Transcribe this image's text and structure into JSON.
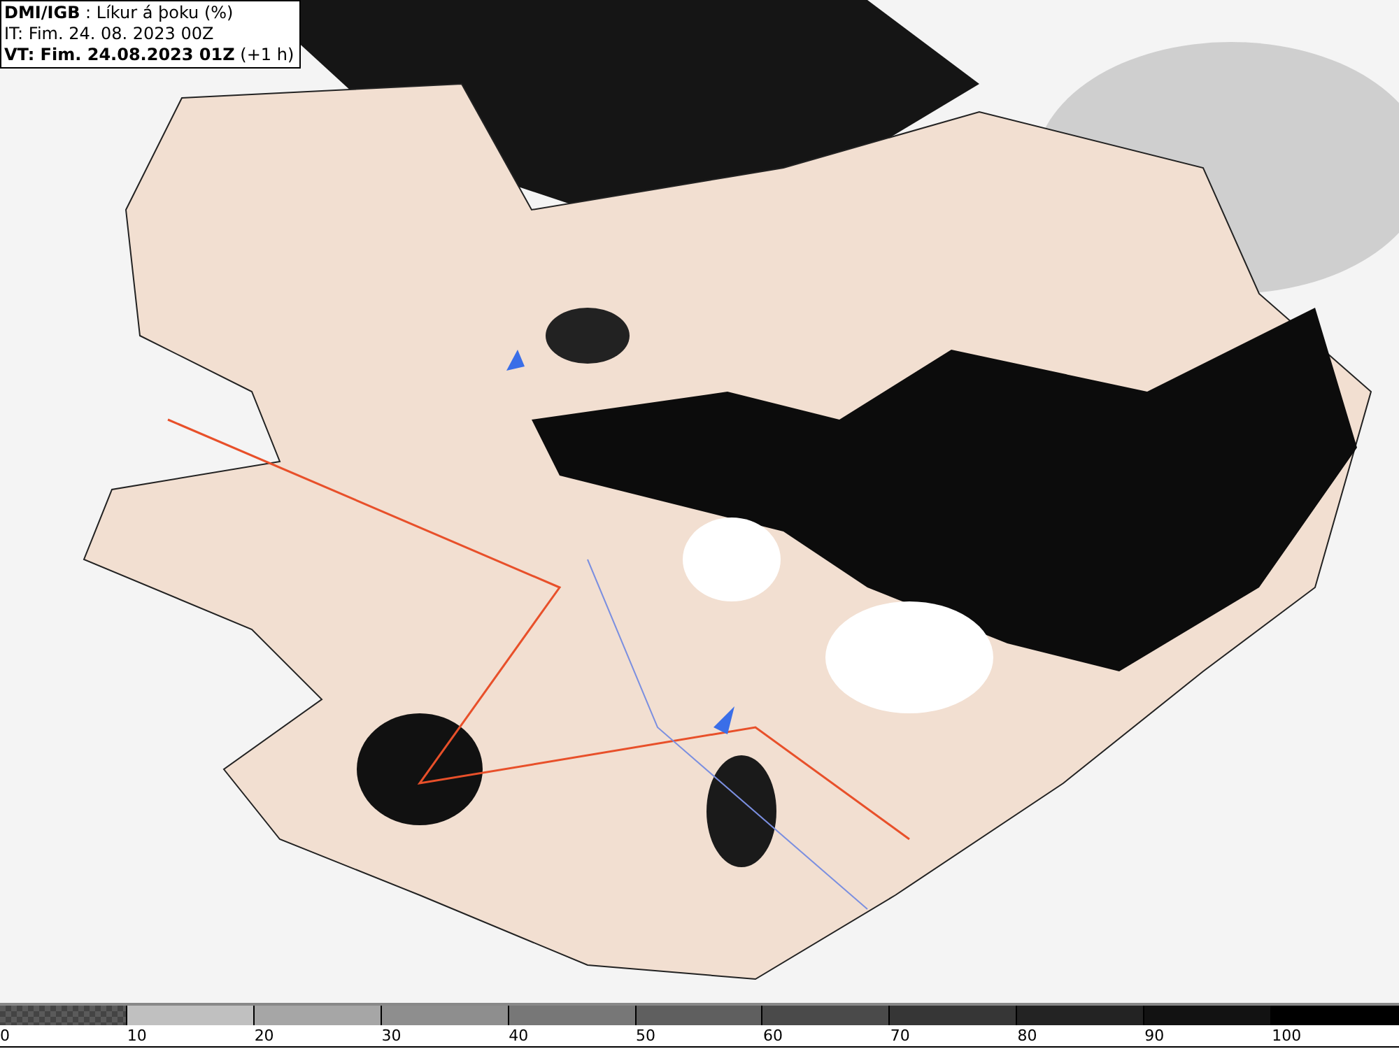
{
  "header": {
    "lines": [
      "**DMI/IGB** : Líkur á þoku (%)",
      "IT: Fim. 24. 08. 2023 00Z",
      "**VT: Fim. 24.08.2023 01Z** (+1 h)"
    ]
  },
  "legend": {
    "segments": [
      {
        "label": "0",
        "kind": "checkered",
        "color": "#5a5a5a"
      },
      {
        "label": "10",
        "kind": "solid",
        "color": "#c0c0c0"
      },
      {
        "label": "20",
        "kind": "solid",
        "color": "#a6a6a6"
      },
      {
        "label": "30",
        "kind": "solid",
        "color": "#8e8e8e"
      },
      {
        "label": "40",
        "kind": "solid",
        "color": "#777777"
      },
      {
        "label": "50",
        "kind": "solid",
        "color": "#5f5f5f"
      },
      {
        "label": "60",
        "kind": "solid",
        "color": "#4a4a4a"
      },
      {
        "label": "70",
        "kind": "solid",
        "color": "#363636"
      },
      {
        "label": "80",
        "kind": "solid",
        "color": "#232323"
      },
      {
        "label": "90",
        "kind": "solid",
        "color": "#121212"
      },
      {
        "label": "100",
        "kind": "solid",
        "color": "#000000"
      }
    ]
  }
}
